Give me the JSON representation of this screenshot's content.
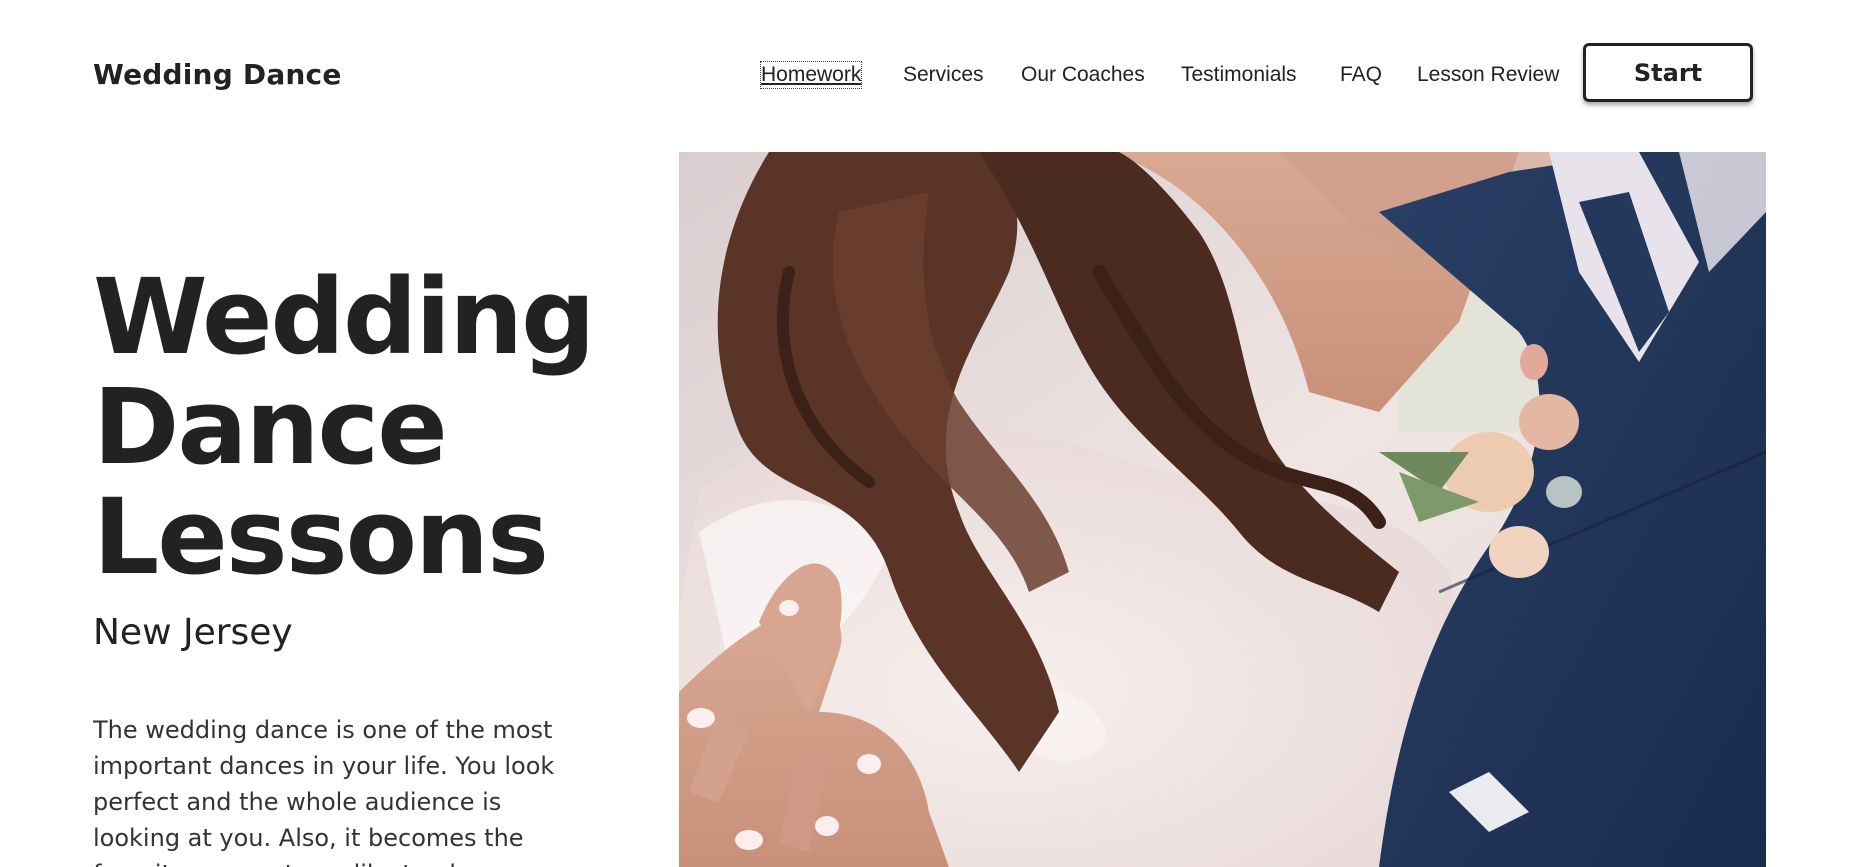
{
  "header": {
    "logo": "Wedding Dance",
    "nav": [
      {
        "label": "Homework"
      },
      {
        "label": "Services"
      },
      {
        "label": "Our Coaches"
      },
      {
        "label": "Testimonials"
      },
      {
        "label": "FAQ"
      },
      {
        "label": "Lesson Review"
      }
    ],
    "cta_label": "Start"
  },
  "hero": {
    "title_lines": [
      "Wedding",
      "Dance",
      "Lessons"
    ],
    "subtitle": "New Jersey",
    "intro": "The wedding dance is one of the most important dances in your life. You look perfect and the whole audience is looking at you. Also, it becomes the favorite moment you like to play on",
    "image_alt": ""
  },
  "colors": {
    "text": "#222222",
    "background": "#ffffff",
    "suit_navy": "#1f3358",
    "dress_white": "#f4ecea",
    "hair_brown": "#4a2d22"
  }
}
